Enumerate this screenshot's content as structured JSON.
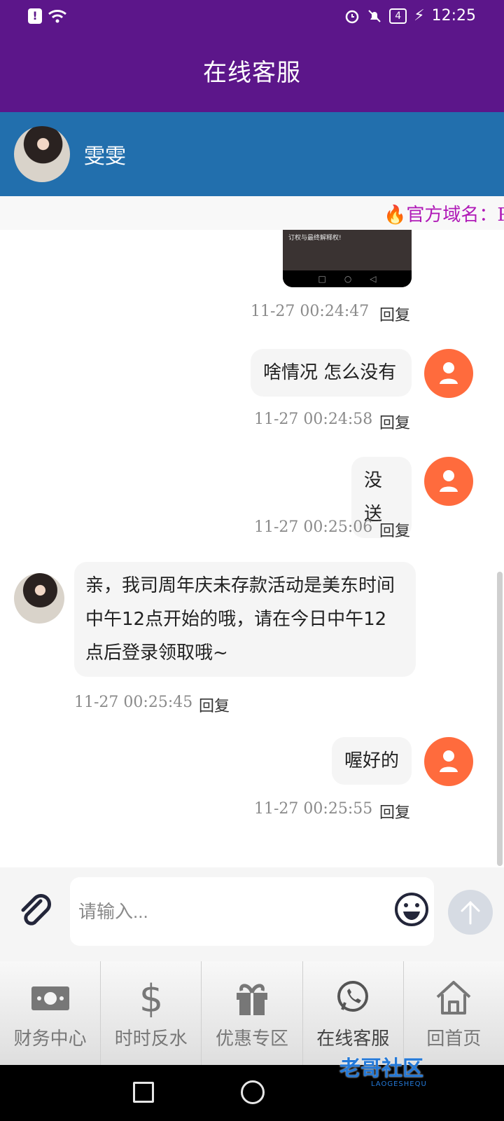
{
  "status_bar": {
    "time": "12:25",
    "battery": "4"
  },
  "header": {
    "title": "在线客服"
  },
  "agent": {
    "name": "雯雯"
  },
  "ticker": {
    "text": "🔥官方域名：P"
  },
  "image_preview": {
    "caption": "订权与最终解释权!"
  },
  "messages": [
    {
      "time": "11-27 00:24:47",
      "reply": "回复"
    },
    {
      "text": "啥情况 怎么没有",
      "time": "11-27 00:24:58",
      "reply": "回复"
    },
    {
      "text": "没送",
      "time": "11-27 00:25:06",
      "reply": "回复"
    },
    {
      "text": "亲，我司周年庆未存款活动是美东时间中午12点开始的哦，请在今日中午12点后登录领取哦~",
      "time": "11-27 00:25:45",
      "reply": "回复"
    },
    {
      "text": "喔好的",
      "time": "11-27 00:25:55",
      "reply": "回复"
    }
  ],
  "input": {
    "placeholder": "请输入..."
  },
  "bottom_nav": [
    {
      "label": "财务中心",
      "icon": "money-icon"
    },
    {
      "label": "时时反水",
      "icon": "dollar-icon"
    },
    {
      "label": "优惠专区",
      "icon": "gift-icon"
    },
    {
      "label": "在线客服",
      "icon": "whatsapp-icon"
    },
    {
      "label": "回首页",
      "icon": "home-icon"
    }
  ],
  "watermark": {
    "text": "老哥社区",
    "sub": "LAOGESHEQU"
  }
}
